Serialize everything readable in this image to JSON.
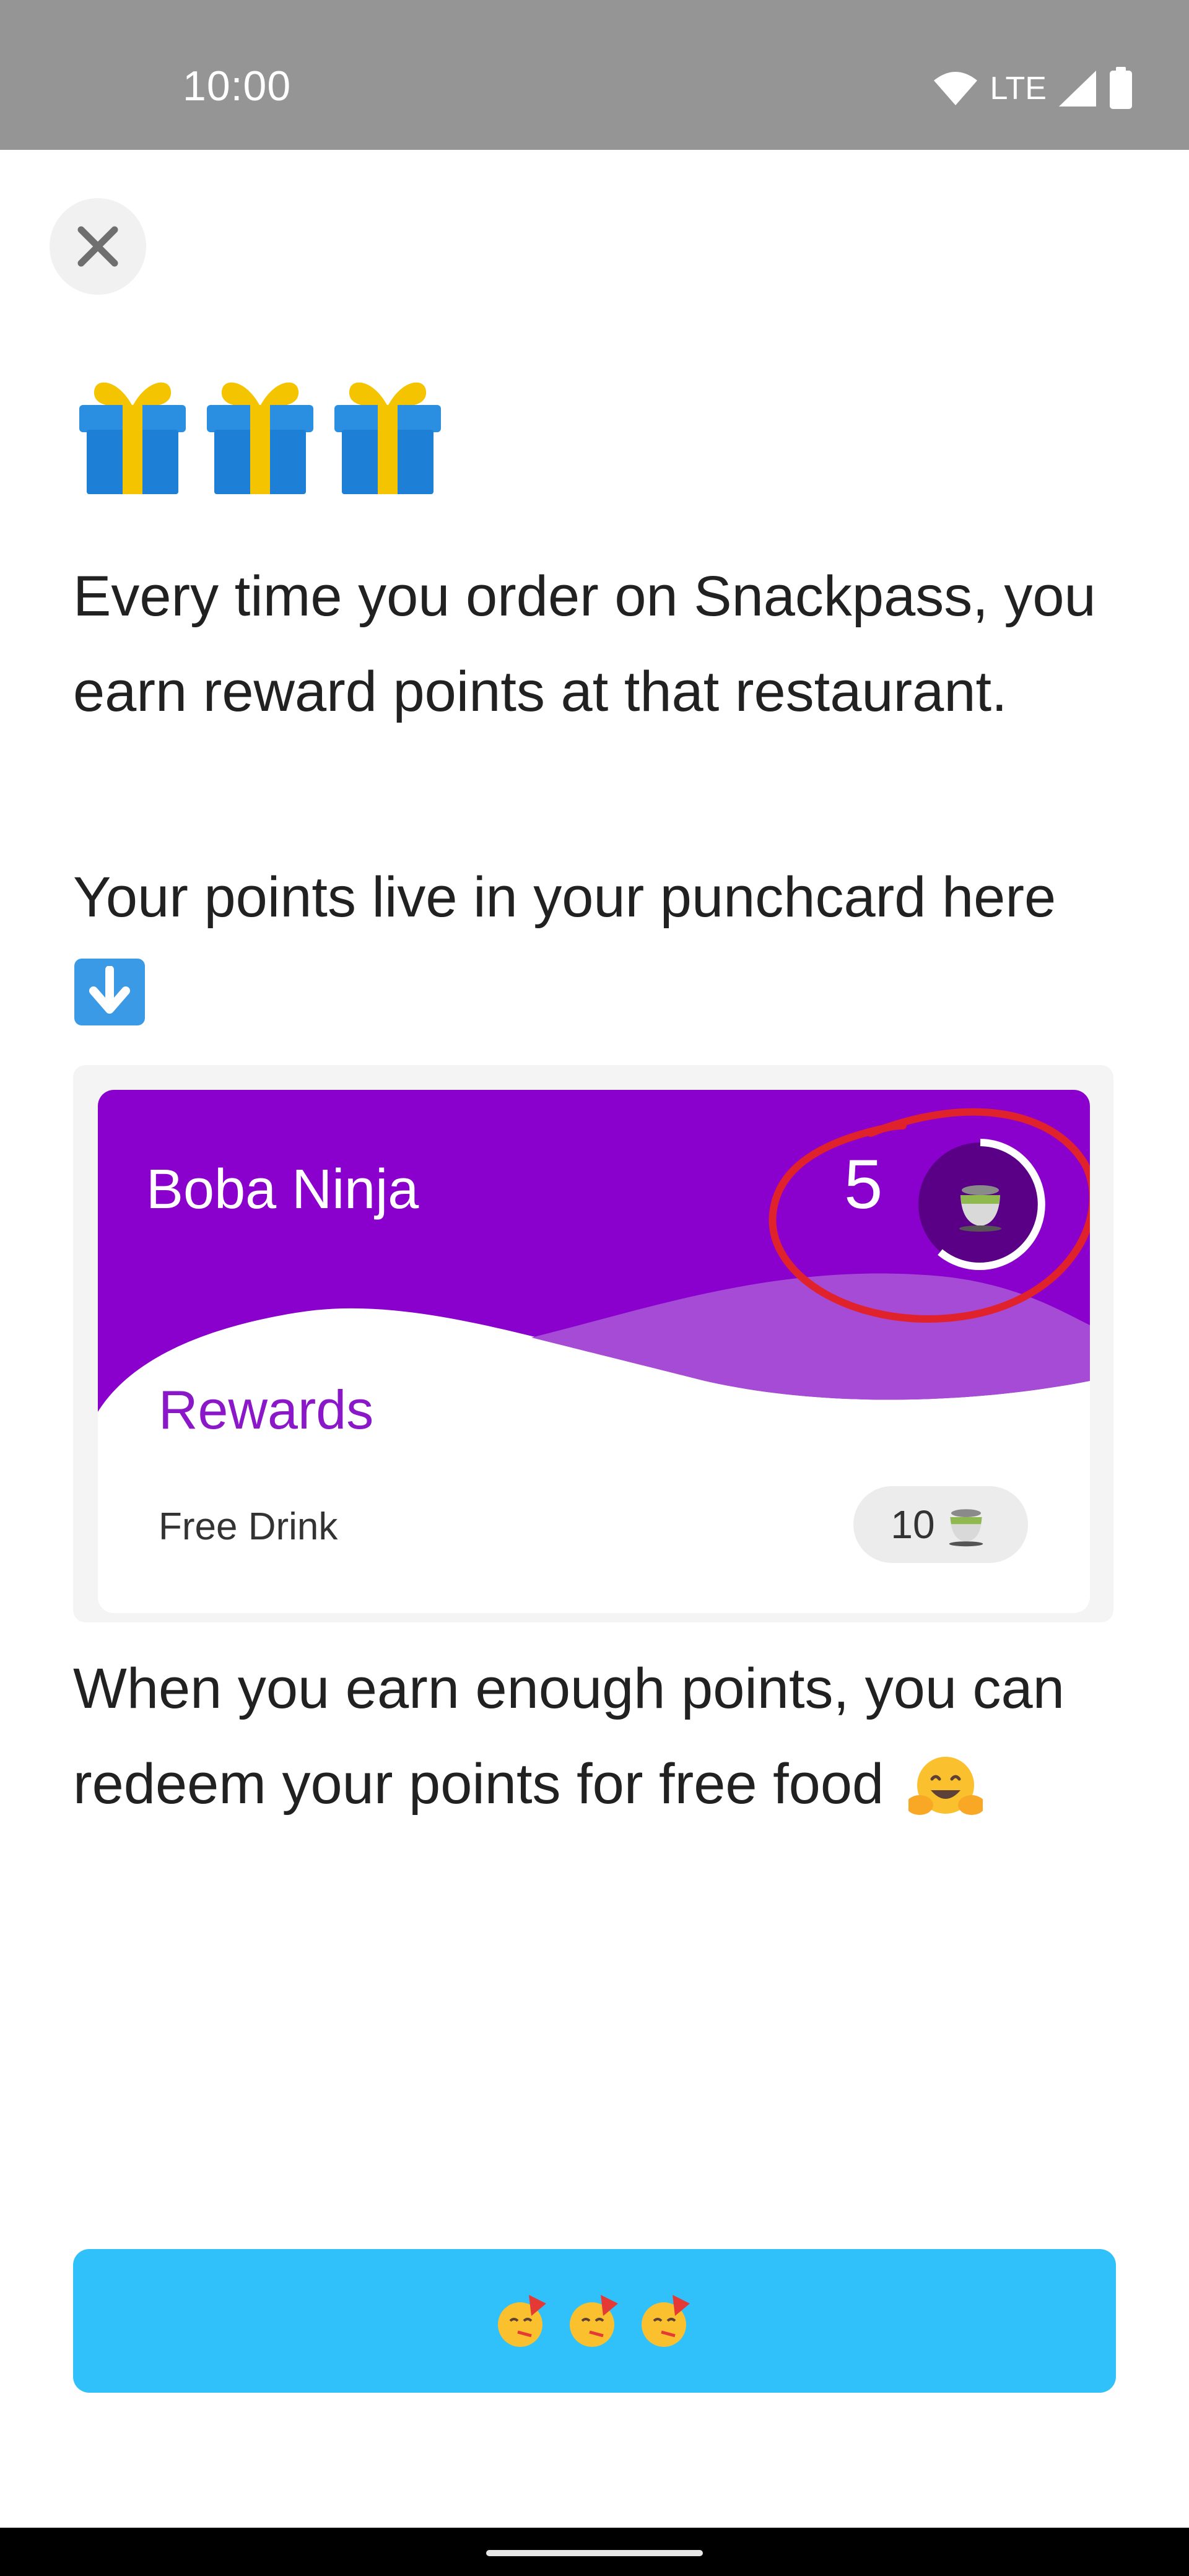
{
  "status_bar": {
    "time": "10:00",
    "network": "LTE",
    "icons": [
      "wifi-icon",
      "cell-signal-icon",
      "battery-icon"
    ]
  },
  "close_button": {
    "icon": "close-icon"
  },
  "header_icons": [
    "gift-icon",
    "gift-icon",
    "gift-icon"
  ],
  "paragraphs": {
    "intro": "Every time you order on Snackpass, you earn reward points at that restaurant.",
    "punchcard": "Your points live in your punchcard here",
    "redeem": "When you earn enough points, you can redeem your points for free food"
  },
  "punchcard_icon": "down-arrow-icon",
  "redeem_icon": "hugging-face-icon",
  "card": {
    "restaurant": "Boba Ninja",
    "points": "5",
    "rewards_title": "Rewards",
    "reward_item": "Free Drink",
    "reward_cost": "10",
    "points_icon": "tea-cup-icon",
    "accent_color": "#8a00cc",
    "highlight_color": "#e0222c"
  },
  "button": {
    "icons": [
      "party-face-icon",
      "party-face-icon",
      "party-face-icon"
    ],
    "color": "#30c1fb"
  }
}
